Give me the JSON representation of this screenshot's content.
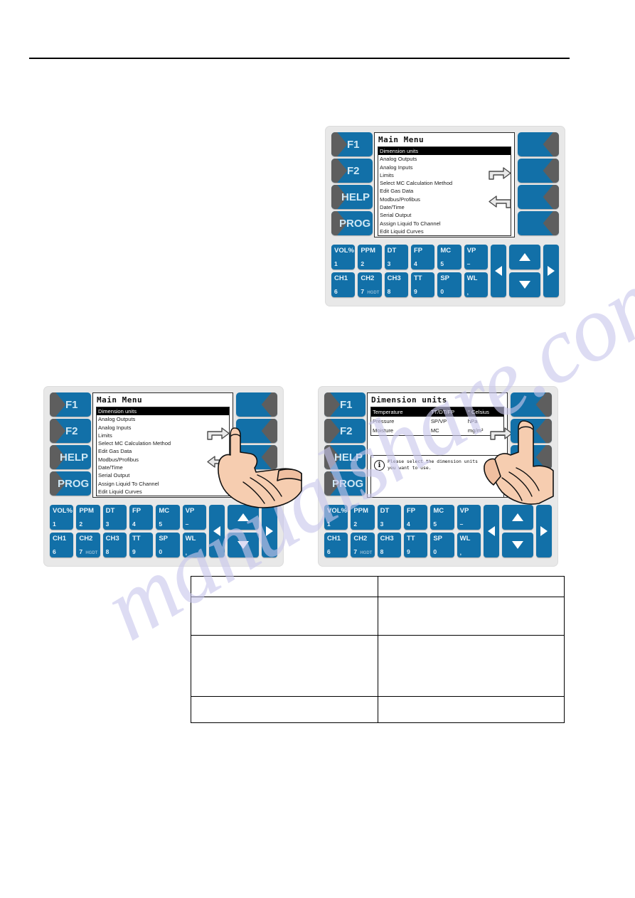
{
  "page": {
    "background_color": "#ffffff",
    "header_rule": true
  },
  "watermark": {
    "text": "manualshare.com",
    "color": "#c9c7ec"
  },
  "device_top": {
    "name": "top-device-illustration",
    "side_keys": [
      "F1",
      "F2",
      "HELP",
      "PROG"
    ],
    "right_keys": [
      "",
      "",
      "",
      ""
    ],
    "screen": {
      "title": "Main Menu",
      "items": [
        "Dimension units",
        "Analog Outputs",
        "Analog Inputs",
        "Limits",
        "Select MC Calculation Method",
        "Edit Gas Data",
        "Modbus/Profibus",
        "Date/Time",
        "Serial Output",
        "Assign Liquid To Channel",
        "Edit Liquid Curves"
      ],
      "selected_index": 0
    },
    "nav_arrows": [
      "turn-right-arrow",
      "turn-left-arrow"
    ],
    "keypad": {
      "row1": [
        {
          "top": "VOL%",
          "bottom": "1",
          "sub": ""
        },
        {
          "top": "PPM",
          "bottom": "2",
          "sub": ""
        },
        {
          "top": "DT",
          "bottom": "3",
          "sub": ""
        },
        {
          "top": "FP",
          "bottom": "4",
          "sub": ""
        },
        {
          "top": "MC",
          "bottom": "5",
          "sub": ""
        },
        {
          "top": "VP",
          "bottom": "–",
          "sub": ""
        }
      ],
      "row2": [
        {
          "top": "CH1",
          "bottom": "6",
          "sub": ""
        },
        {
          "top": "CH2",
          "bottom": "7",
          "sub": "HGDT"
        },
        {
          "top": "CH3",
          "bottom": "8",
          "sub": ""
        },
        {
          "top": "TT",
          "bottom": "9",
          "sub": ""
        },
        {
          "top": "SP",
          "bottom": "0",
          "sub": ""
        },
        {
          "top": "WL",
          "bottom": ",",
          "sub": ""
        }
      ]
    }
  },
  "device_bottom_left": {
    "name": "bottom-left-device-illustration",
    "side_keys": [
      "F1",
      "F2",
      "HELP",
      "PROG"
    ],
    "right_keys": [
      "",
      "",
      "",
      ""
    ],
    "screen": {
      "title": "Main Menu",
      "items": [
        "Dimension units",
        "Analog Outputs",
        "Analog Inputs",
        "Limits",
        "Select MC Calculation Method",
        "Edit Gas Data",
        "Modbus/Profibus",
        "Date/Time",
        "Serial Output",
        "Assign Liquid To Channel",
        "Edit Liquid Curves"
      ],
      "selected_index": 0
    },
    "nav_arrows": [
      "turn-right-arrow",
      "turn-left-arrow"
    ],
    "hand_pointer": "pointing-hand-illustration",
    "keypad": {
      "row1": [
        {
          "top": "VOL%",
          "bottom": "1",
          "sub": ""
        },
        {
          "top": "PPM",
          "bottom": "2",
          "sub": ""
        },
        {
          "top": "DT",
          "bottom": "3",
          "sub": ""
        },
        {
          "top": "FP",
          "bottom": "4",
          "sub": ""
        },
        {
          "top": "MC",
          "bottom": "5",
          "sub": ""
        },
        {
          "top": "VP",
          "bottom": "–",
          "sub": ""
        }
      ],
      "row2": [
        {
          "top": "CH1",
          "bottom": "6",
          "sub": ""
        },
        {
          "top": "CH2",
          "bottom": "7",
          "sub": "HGDT"
        },
        {
          "top": "CH3",
          "bottom": "8",
          "sub": ""
        },
        {
          "top": "TT",
          "bottom": "9",
          "sub": ""
        },
        {
          "top": "SP",
          "bottom": "0",
          "sub": ""
        },
        {
          "top": "WL",
          "bottom": ",",
          "sub": ""
        }
      ]
    }
  },
  "device_bottom_right": {
    "name": "bottom-right-device-illustration",
    "side_keys": [
      "F1",
      "F2",
      "HELP",
      "PROG"
    ],
    "right_keys": [
      "",
      "",
      "",
      ""
    ],
    "screen": {
      "title": "Dimension units",
      "table_rows": [
        {
          "label": "Temperature",
          "channels": "TT/DT/FP",
          "unit": "° Celsius",
          "selected": true
        },
        {
          "label": "Pressure",
          "channels": "SP/VP",
          "unit": "hPa",
          "selected": false
        },
        {
          "label": "Moisture",
          "channels": "MC",
          "unit": "mg/m³",
          "selected": false
        }
      ],
      "info": {
        "icon": "info-circle-icon",
        "line1": "Please select the dimension units",
        "line2": "you want to use."
      }
    },
    "nav_arrows": [
      "turn-right-arrow"
    ],
    "hand_pointer": "pointing-hand-illustration",
    "keypad": {
      "row1": [
        {
          "top": "VOL%",
          "bottom": "1",
          "sub": ""
        },
        {
          "top": "PPM",
          "bottom": "2",
          "sub": ""
        },
        {
          "top": "DT",
          "bottom": "3",
          "sub": ""
        },
        {
          "top": "FP",
          "bottom": "4",
          "sub": ""
        },
        {
          "top": "MC",
          "bottom": "5",
          "sub": ""
        },
        {
          "top": "VP",
          "bottom": "–",
          "sub": ""
        }
      ],
      "row2": [
        {
          "top": "CH1",
          "bottom": "6",
          "sub": ""
        },
        {
          "top": "CH2",
          "bottom": "7",
          "sub": "HGDT"
        },
        {
          "top": "CH3",
          "bottom": "8",
          "sub": ""
        },
        {
          "top": "TT",
          "bottom": "9",
          "sub": ""
        },
        {
          "top": "SP",
          "bottom": "0",
          "sub": ""
        },
        {
          "top": "WL",
          "bottom": ",",
          "sub": ""
        }
      ]
    }
  },
  "bottom_table": {
    "name": "instruction-table",
    "columns": [
      "",
      ""
    ],
    "rows": [
      [
        "",
        ""
      ],
      [
        "",
        ""
      ],
      [
        "",
        ""
      ],
      [
        "",
        ""
      ]
    ]
  },
  "colors": {
    "key_blue": "#1270a8",
    "key_notch_gray": "#5e5e5e",
    "panel_gray": "#e8e8e8",
    "lcd_white": "#ffffff",
    "lcd_text": "#1b1b1b",
    "selection_black": "#000000",
    "watermark": "#c9c7ec"
  }
}
